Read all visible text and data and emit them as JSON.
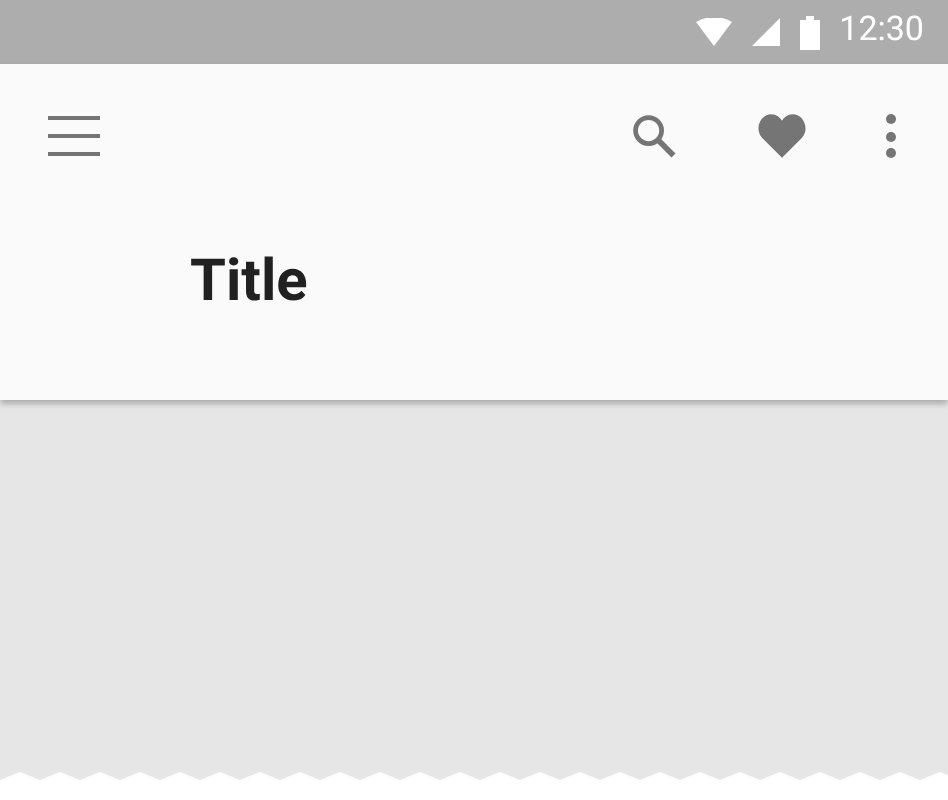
{
  "status_bar": {
    "time": "12:30"
  },
  "app_bar": {
    "title": "Title"
  }
}
